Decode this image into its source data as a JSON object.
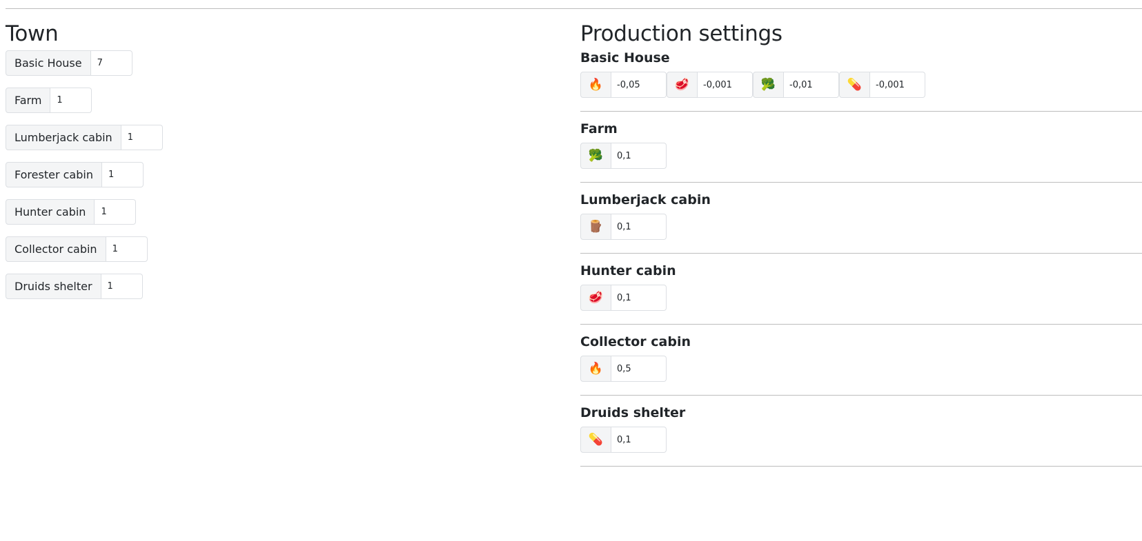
{
  "town": {
    "title": "Town",
    "rows": [
      {
        "label": "Basic House",
        "value": "7"
      },
      {
        "label": "Farm",
        "value": "1"
      },
      {
        "label": "Lumberjack cabin",
        "value": "1"
      },
      {
        "label": "Forester cabin",
        "value": "1"
      },
      {
        "label": "Hunter cabin",
        "value": "1"
      },
      {
        "label": "Collector cabin",
        "value": "1"
      },
      {
        "label": "Druids shelter",
        "value": "1"
      }
    ]
  },
  "production": {
    "title": "Production settings",
    "buildings": [
      {
        "title": "Basic House",
        "resources": [
          {
            "icon": "fire-icon",
            "glyph": "🔥",
            "value": "-0,05"
          },
          {
            "icon": "meat-icon",
            "glyph": "🥩",
            "value": "-0,001"
          },
          {
            "icon": "broccoli-icon",
            "glyph": "🥦",
            "value": "-0,01"
          },
          {
            "icon": "pill-icon",
            "glyph": "💊",
            "value": "-0,001"
          }
        ]
      },
      {
        "title": "Farm",
        "resources": [
          {
            "icon": "broccoli-icon",
            "glyph": "🥦",
            "value": "0,1"
          }
        ]
      },
      {
        "title": "Lumberjack cabin",
        "resources": [
          {
            "icon": "wood-log-icon",
            "glyph": "🪵",
            "value": "0,1"
          }
        ]
      },
      {
        "title": "Hunter cabin",
        "resources": [
          {
            "icon": "meat-icon",
            "glyph": "🥩",
            "value": "0,1"
          }
        ]
      },
      {
        "title": "Collector cabin",
        "resources": [
          {
            "icon": "fire-icon",
            "glyph": "🔥",
            "value": "0,5"
          }
        ]
      },
      {
        "title": "Druids shelter",
        "resources": [
          {
            "icon": "pill-icon",
            "glyph": "💊",
            "value": "0,1"
          }
        ]
      }
    ]
  }
}
